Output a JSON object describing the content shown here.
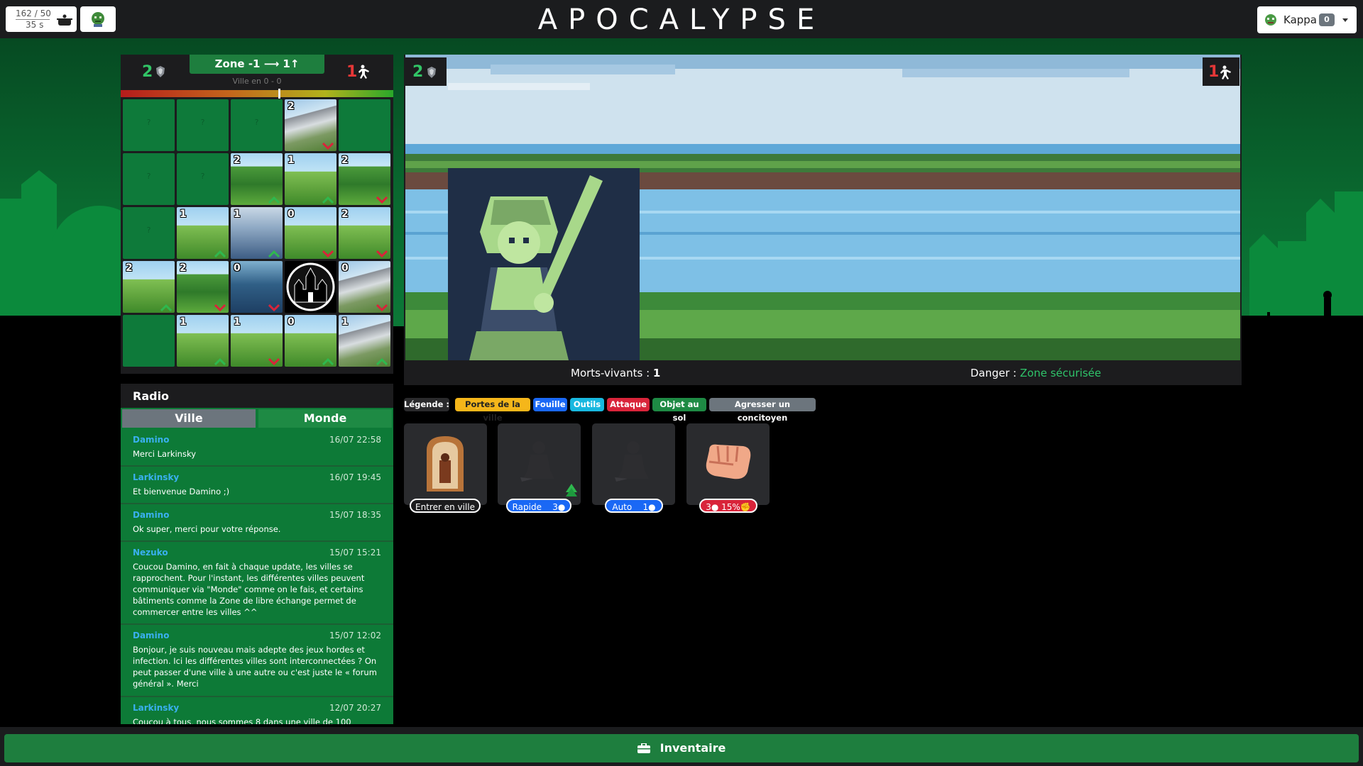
{
  "header": {
    "title": "APOCALYPSE",
    "stats": {
      "ap": "162 / 50",
      "time": "35 s"
    },
    "user": {
      "name": "Kappa",
      "badge": "0"
    }
  },
  "map": {
    "zone_label": "Zone -1 ⟶ 1↑",
    "ville_sub": "Ville en 0 - 0",
    "allies": "2",
    "zombies": "1",
    "danger_level": 0.58,
    "cells": [
      [
        "?",
        "?",
        "?",
        "2",
        ""
      ],
      [
        "?",
        "?",
        "2",
        "1",
        "2"
      ],
      [
        "?",
        "1",
        "1",
        "0",
        "2"
      ],
      [
        "2",
        "2",
        "0",
        "",
        "0"
      ],
      [
        "",
        "1",
        "1",
        "0",
        "1"
      ]
    ]
  },
  "radio": {
    "title": "Radio",
    "tabs": {
      "ville": "Ville",
      "monde": "Monde"
    },
    "messages": [
      {
        "author": "Damino",
        "date": "16/07 22:58",
        "text": "Merci Larkinsky"
      },
      {
        "author": "Larkinsky",
        "date": "16/07 19:45",
        "text": "Et bienvenue Damino ;)"
      },
      {
        "author": "Damino",
        "date": "15/07 18:35",
        "text": "Ok super, merci pour votre réponse."
      },
      {
        "author": "Nezuko",
        "date": "15/07 15:21",
        "text": "Coucou Damino, en fait à chaque update, les villes se rapprochent. Pour l'instant, les différentes villes peuvent communiquer via \"Monde\" comme on le fais, et certains bâtiments comme la Zone de libre échange permet de commercer entre les villes ^^"
      },
      {
        "author": "Damino",
        "date": "15/07 12:02",
        "text": "Bonjour, je suis nouveau mais adepte des jeux hordes et infection. Ici les différentes villes sont interconnectées ? On peut passer d'une ville à une autre ou c'est juste le « forum général ». Merci"
      },
      {
        "author": "Larkinsky",
        "date": "12/07 20:27",
        "text": "Coucou à tous, nous sommes 8 dans une ville de 100"
      }
    ]
  },
  "scene": {
    "allies": "2",
    "zombies": "1",
    "undead_label": "Morts-vivants :",
    "undead_count": "1",
    "danger_label": "Danger :",
    "danger_value": "Zone sécurisée"
  },
  "legend": {
    "title": "Légende :",
    "portes": "Portes de la ville",
    "fouille": "Fouille",
    "outils": "Outils",
    "attaque": "Attaque",
    "objet": "Objet au sol",
    "agresser": "Agresser un concitoyen"
  },
  "actions": [
    {
      "label": "Entrer en ville"
    },
    {
      "label": "Rapide",
      "cost": "3"
    },
    {
      "label": "Auto",
      "cost": "1"
    },
    {
      "label": "3",
      "extra": "15%"
    }
  ],
  "inventory": {
    "label": "Inventaire"
  },
  "colors": {
    "accent_green": "#1e7e3e",
    "danger_red": "#e53737",
    "safe_green": "#2fc46a"
  }
}
